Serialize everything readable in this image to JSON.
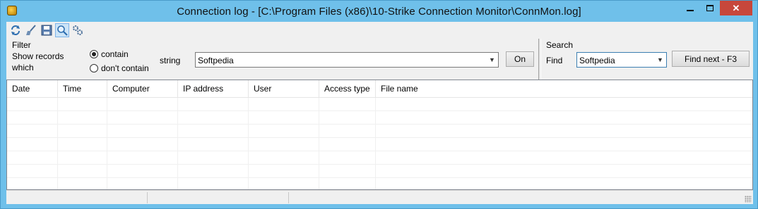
{
  "window": {
    "title": "Connection log - [C:\\Program Files (x86)\\10-Strike Connection Monitor\\ConnMon.log]",
    "close_glyph": "✕"
  },
  "toolbar": {
    "icons": [
      "refresh-icon",
      "clear-icon",
      "save-icon",
      "search-icon",
      "settings-icon"
    ]
  },
  "filter": {
    "section_label": "Filter",
    "show_records_line1": "Show records",
    "show_records_line2": "which",
    "options": [
      {
        "label": "contain",
        "selected": true
      },
      {
        "label": "don't contain",
        "selected": false
      }
    ],
    "string_label": "string",
    "string_value": "Softpedia",
    "on_button": "On"
  },
  "search": {
    "section_label": "Search",
    "find_label": "Find",
    "find_value": "Softpedia",
    "find_next_button": "Find next - F3"
  },
  "grid": {
    "columns": [
      "Date",
      "Time",
      "Computer",
      "IP address",
      "User",
      "Access type",
      "File name"
    ],
    "rows": []
  },
  "colors": {
    "titlebar": "#6fc0ea",
    "close_button": "#c7473b",
    "active_tool": "#cce4f7"
  }
}
